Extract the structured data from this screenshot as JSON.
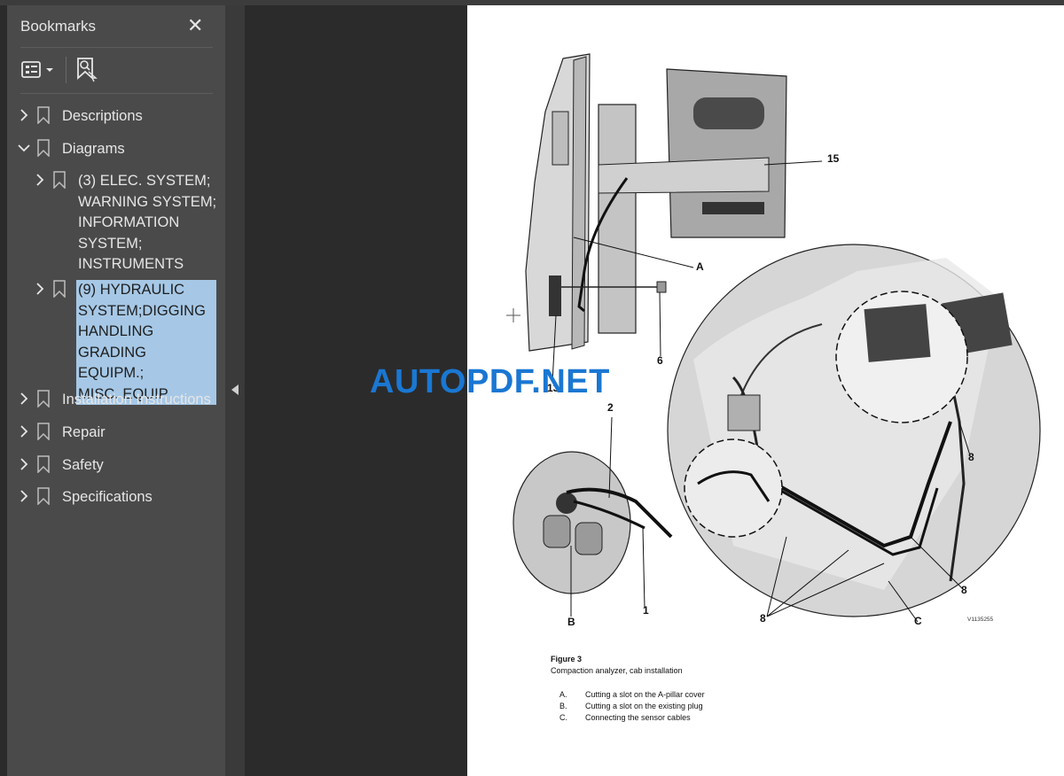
{
  "sidebar": {
    "title": "Bookmarks",
    "close_icon": "close-icon",
    "toolbar": {
      "options_icon": "list-options-icon",
      "find_icon": "find-bookmark-icon"
    },
    "items": [
      {
        "label": "Descriptions",
        "expanded": false
      },
      {
        "label": "Diagrams",
        "expanded": true,
        "children": [
          {
            "label": "(3) ELEC. SYSTEM;\nWARNING SYSTEM;\nINFORMATION\nSYSTEM;\nINSTRUMENTS",
            "expanded": false
          },
          {
            "label": "(9) HYDRAULIC\nSYSTEM;DIGGING\nHANDLING\nGRADING EQUIPM.;\nMISC. EQUIP",
            "expanded": false,
            "selected": true
          }
        ]
      },
      {
        "label": "Installation Instructions",
        "expanded": false
      },
      {
        "label": "Repair",
        "expanded": false
      },
      {
        "label": "Safety",
        "expanded": false
      },
      {
        "label": "Specifications",
        "expanded": false
      }
    ]
  },
  "watermark": "AUTOPDF.NET",
  "document": {
    "callouts": {
      "c15": "15",
      "cA": "A",
      "c6": "6",
      "c13": "13",
      "c2": "2",
      "c8a": "8",
      "c8b": "8",
      "c8c": "8",
      "cB": "B",
      "c1": "1",
      "cC": "C"
    },
    "image_id": "V1135255",
    "figure_label": "Figure 3",
    "figure_title": "Compaction analyzer, cab installation",
    "legend": [
      {
        "key": "A.",
        "text": "Cutting a slot on the A-pillar cover"
      },
      {
        "key": "B.",
        "text": "Cutting a slot on the existing plug"
      },
      {
        "key": "C.",
        "text": "Connecting the sensor cables"
      }
    ]
  },
  "colors": {
    "sidebar_bg": "#4a4a4a",
    "selection": "#a6c8e6",
    "watermark": "#1a77d2",
    "viewer_bg": "#2b2b2b"
  }
}
